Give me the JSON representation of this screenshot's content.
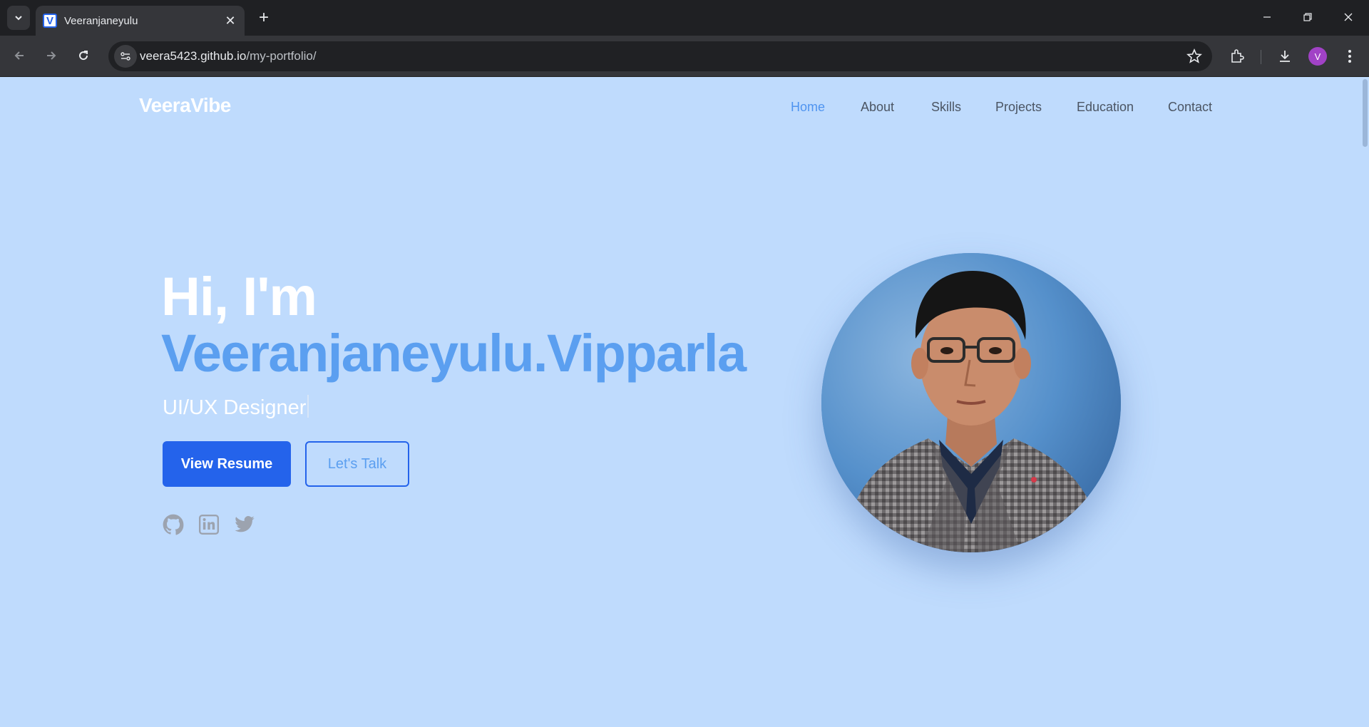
{
  "browser": {
    "tab_title": "Veeranjaneyulu",
    "favicon_letter": "V",
    "url_host": "veera5423.github.io",
    "url_path": "/my-portfolio/",
    "profile_initial": "V",
    "tab_close_glyph": "✕",
    "new_tab_glyph": "+",
    "icons": [
      "tab-search-icon",
      "back-icon",
      "forward-icon",
      "reload-icon",
      "site-info-icon",
      "star-icon",
      "extensions-icon",
      "download-icon",
      "menu-icon",
      "minimize-icon",
      "restore-icon",
      "close-icon"
    ]
  },
  "site": {
    "brand": "VeeraVibe",
    "nav": [
      {
        "label": "Home",
        "active": true
      },
      {
        "label": "About",
        "active": false
      },
      {
        "label": "Skills",
        "active": false
      },
      {
        "label": "Projects",
        "active": false
      },
      {
        "label": "Education",
        "active": false
      },
      {
        "label": "Contact",
        "active": false
      }
    ],
    "hero": {
      "greeting": "Hi, I'm",
      "name": "Veeranjaneyulu.Vipparla",
      "role": "UI/UX Designer",
      "primary_button": "View Resume",
      "secondary_button": "Let's Talk",
      "socials": [
        "github-icon",
        "linkedin-icon",
        "twitter-icon"
      ]
    },
    "colors": {
      "background": "#bfdbfd",
      "accent": "#2463eb",
      "name_blue": "#5b9ff0",
      "nav_active": "#4f94f0",
      "nav_text": "#4b5563"
    }
  }
}
